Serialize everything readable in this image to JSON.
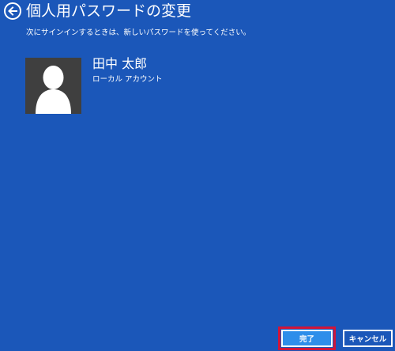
{
  "header": {
    "back_icon": "back-arrow-icon",
    "title": "個人用パスワードの変更"
  },
  "instruction": "次にサインインするときは、新しいパスワードを使ってください。",
  "user": {
    "avatar_icon": "user-silhouette-icon",
    "name": "田中 太郎",
    "account_type": "ローカル アカウント"
  },
  "buttons": {
    "finish_label": "完了",
    "cancel_label": "キャンセル"
  },
  "colors": {
    "background": "#1b57b9",
    "primary_button": "#2e8eea",
    "focus_border": "#d0153a",
    "avatar_background": "#3f3f3f"
  }
}
